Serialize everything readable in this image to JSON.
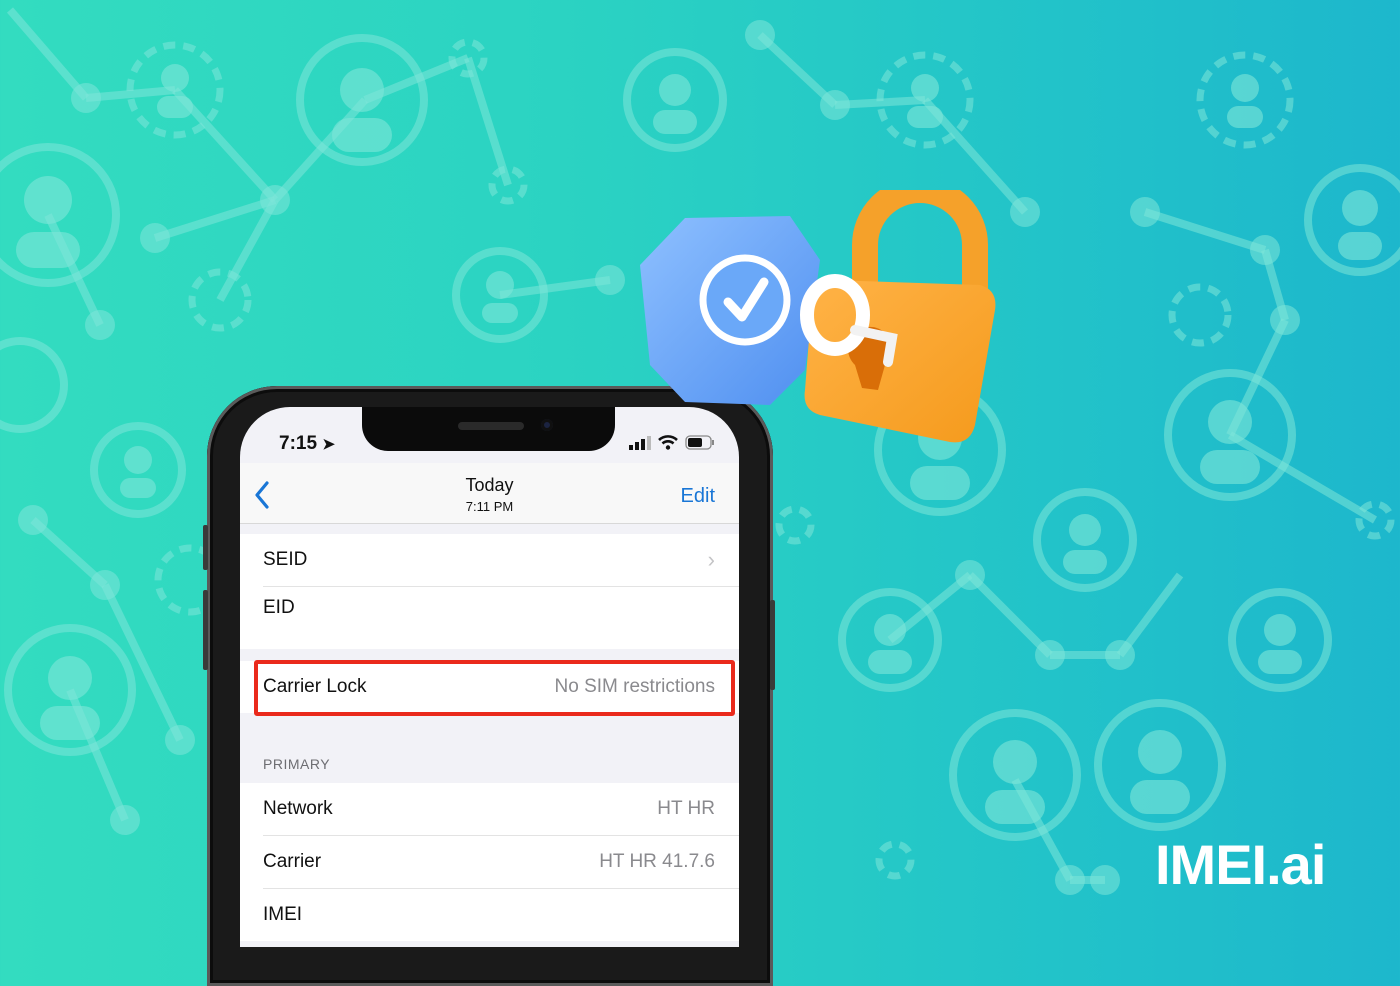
{
  "brand": {
    "logo_text": "IMEI.ai",
    "background_start": "#33dcc0",
    "background_end": "#1db7cc",
    "accent": "#1976d6",
    "highlight": "#ea2a1c"
  },
  "illustration": {
    "shield_icon": "shield-check-icon",
    "key_icon": "key-icon",
    "lock_icon": "padlock-icon"
  },
  "phone": {
    "status_bar": {
      "time": "7:15",
      "location_icon": "location-arrow-icon",
      "signal_icon": "signal-icon",
      "wifi_icon": "wifi-icon",
      "battery_icon": "battery-icon"
    },
    "nav": {
      "back_icon": "chevron-left-icon",
      "title": "Today",
      "subtitle": "7:11 PM",
      "edit_label": "Edit"
    },
    "rows_top": [
      {
        "label": "SEID",
        "value": "",
        "chevron": true
      },
      {
        "label": "EID",
        "value": ""
      }
    ],
    "carrier_lock": {
      "label": "Carrier Lock",
      "value": "No SIM restrictions"
    },
    "section_header": "PRIMARY",
    "rows_primary": [
      {
        "label": "Network",
        "value": "HT HR"
      },
      {
        "label": "Carrier",
        "value": "HT HR 41.7.6"
      },
      {
        "label": "IMEI",
        "value": ""
      }
    ]
  }
}
